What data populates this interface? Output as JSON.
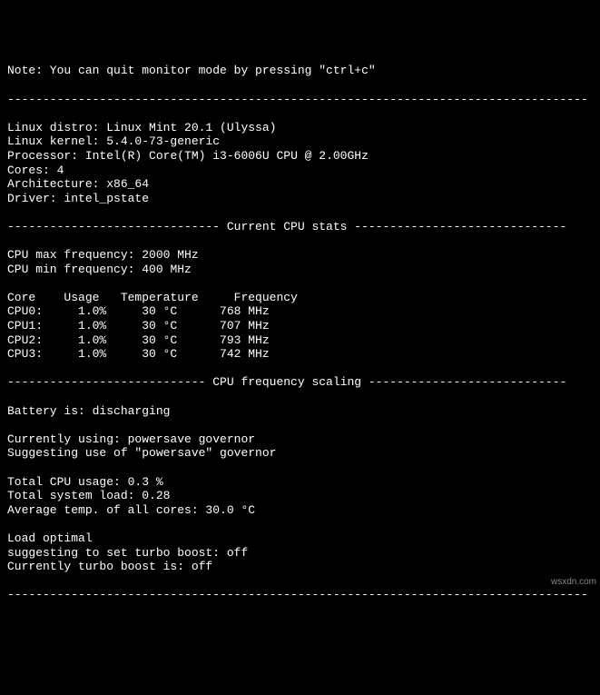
{
  "note": "Note: You can quit monitor mode by pressing \"ctrl+c\"",
  "divider": "----------------------------------------------------------------------------------",
  "system": {
    "distro_label": "Linux distro: ",
    "distro": "Linux Mint 20.1 (Ulyssa)",
    "kernel_label": "Linux kernel: ",
    "kernel": "5.4.0-73-generic",
    "processor_label": "Processor: ",
    "processor": "Intel(R) Core(TM) i3-6006U CPU @ 2.00GHz",
    "cores_label": "Cores: ",
    "cores": "4",
    "arch_label": "Architecture: ",
    "arch": "x86_64",
    "driver_label": "Driver: ",
    "driver": "intel_pstate"
  },
  "stats_header": "------------------------------ Current CPU stats ------------------------------",
  "freq": {
    "max_label": "CPU max frequency: ",
    "max": "2000 MHz",
    "min_label": "CPU min frequency: ",
    "min": "400 MHz"
  },
  "table_header": "Core    Usage   Temperature     Frequency",
  "cores": [
    {
      "row": "CPU0:     1.0%     30 °C      768 MHz"
    },
    {
      "row": "CPU1:     1.0%     30 °C      707 MHz"
    },
    {
      "row": "CPU2:     1.0%     30 °C      793 MHz"
    },
    {
      "row": "CPU3:     1.0%     30 °C      742 MHz"
    }
  ],
  "scaling_header": "---------------------------- CPU frequency scaling ----------------------------",
  "battery": "Battery is: discharging",
  "governor": {
    "current": "Currently using: powersave governor",
    "suggest": "Suggesting use of \"powersave\" governor"
  },
  "totals": {
    "usage": "Total CPU usage: 0.3 %",
    "load": "Total system load: 0.28",
    "temp": "Average temp. of all cores: 30.0 °C"
  },
  "turbo": {
    "load": "Load optimal",
    "suggest": "suggesting to set turbo boost: off",
    "current": "Currently turbo boost is: off"
  },
  "watermark": "wsxdn.com"
}
